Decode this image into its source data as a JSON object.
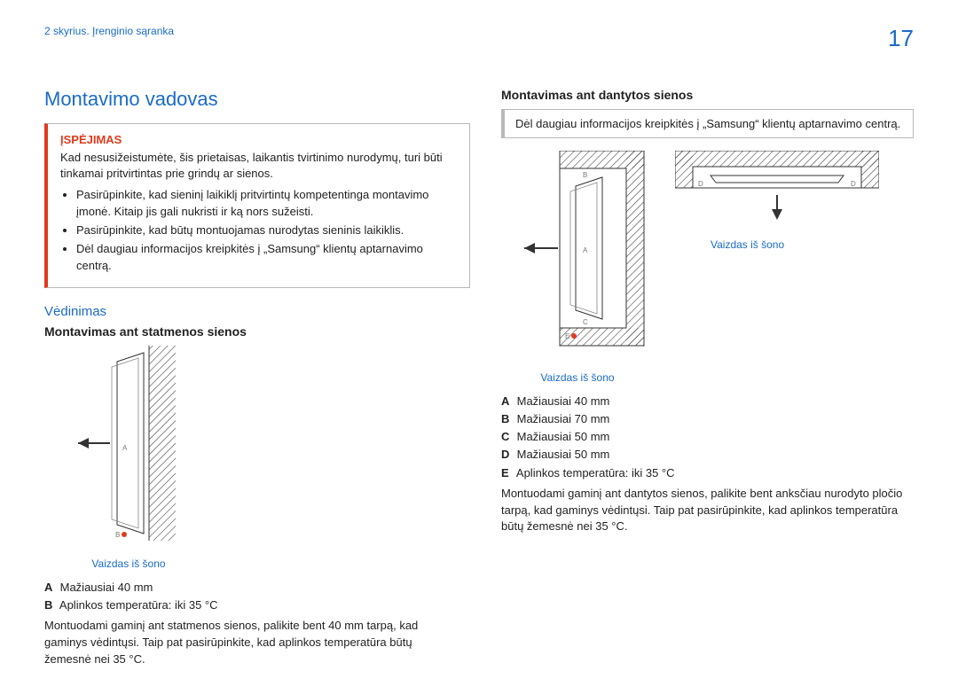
{
  "header": {
    "chapter": "2 skyrius. Įrenginio sąranka",
    "page_number": "17"
  },
  "left": {
    "title": "Montavimo vadovas",
    "warning": {
      "title": "ĮSPĖJIMAS",
      "lead": "Kad nesusižeistumėte, šis prietaisas, laikantis tvirtinimo nurodymų, turi būti tinkamai pritvirtintas prie grindų ar sienos.",
      "bullets": [
        "Pasirūpinkite, kad sieninį laikiklį pritvirtintų kompetentinga montavimo įmonė. Kitaip jis gali nukristi ir ką nors sužeisti.",
        "Pasirūpinkite, kad būtų montuojamas nurodytas sieninis laikiklis.",
        "Dėl daugiau informacijos kreipkitės į „Samsung“ klientų aptarnavimo centrą."
      ]
    },
    "ventilation_title": "Vėdinimas",
    "section1_heading": "Montavimas ant statmenos sienos",
    "fig1": {
      "side_view": "Vaizdas iš šono",
      "label_a": "A",
      "label_b": "B"
    },
    "legend1": {
      "A": "Mažiausiai 40 mm",
      "B": "Aplinkos temperatūra: iki 35 °C"
    },
    "para1": "Montuodami gaminį ant statmenos sienos, palikite bent 40 mm tarpą, kad gaminys vėdintųsi. Taip pat pasirūpinkite, kad aplinkos temperatūra būtų žemesnė nei 35 °C."
  },
  "right": {
    "section2_heading": "Montavimas ant dantytos sienos",
    "info": "Dėl daugiau informacijos kreipkitės į „Samsung“ klientų aptarnavimo centrą.",
    "fig2": {
      "side_view_main": "Vaizdas iš šono",
      "side_view_top": "Vaizdas iš šono",
      "label_a": "A",
      "label_b": "B",
      "label_c": "C",
      "label_d": "D",
      "label_e": "E"
    },
    "legend2": {
      "A": "Mažiausiai 40 mm",
      "B": "Mažiausiai 70 mm",
      "C": "Mažiausiai 50 mm",
      "D": "Mažiausiai 50 mm",
      "E": "Aplinkos temperatūra: iki 35 °C"
    },
    "para2": "Montuodami gaminį ant dantytos sienos, palikite bent anksčiau nurodyto pločio tarpą, kad gaminys vėdintųsi. Taip pat pasirūpinkite, kad aplinkos temperatūra būtų žemesnė nei 35 °C."
  }
}
